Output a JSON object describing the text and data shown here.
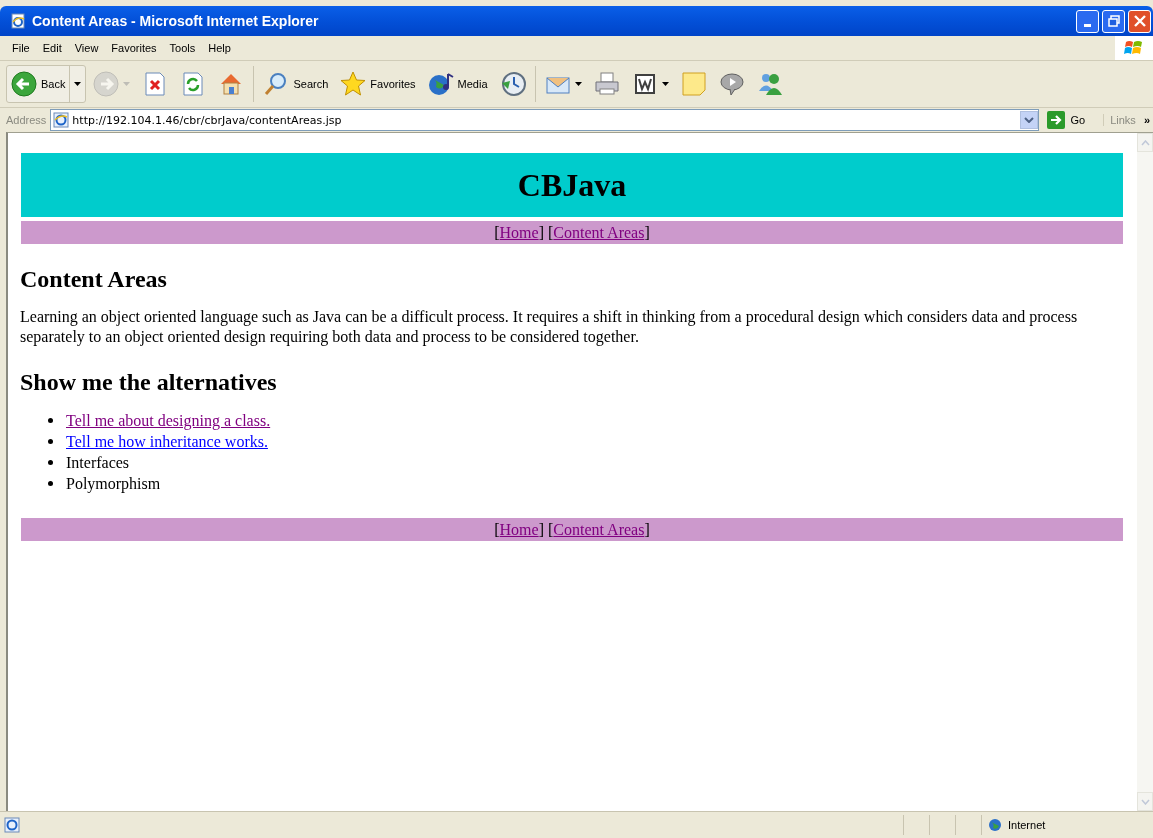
{
  "window": {
    "title": "Content Areas - Microsoft Internet Explorer"
  },
  "menu": [
    {
      "label": "File"
    },
    {
      "label": "Edit"
    },
    {
      "label": "View"
    },
    {
      "label": "Favorites"
    },
    {
      "label": "Tools"
    },
    {
      "label": "Help"
    }
  ],
  "toolbar": [
    {
      "kind": "back",
      "label": "Back",
      "disabled": false
    },
    {
      "kind": "forward",
      "disabled": true
    },
    {
      "kind": "stop",
      "disabled": false
    },
    {
      "kind": "refresh",
      "disabled": false
    },
    {
      "kind": "home",
      "disabled": false
    },
    {
      "kind": "search",
      "label": "Search",
      "disabled": false
    },
    {
      "kind": "favorites",
      "label": "Favorites",
      "disabled": false
    },
    {
      "kind": "media",
      "label": "Media",
      "disabled": false
    },
    {
      "kind": "history",
      "disabled": false
    },
    {
      "kind": "mail",
      "disabled": false
    },
    {
      "kind": "print",
      "disabled": false
    },
    {
      "kind": "edit",
      "disabled": false
    },
    {
      "kind": "note",
      "disabled": false
    },
    {
      "kind": "discuss",
      "disabled": false
    },
    {
      "kind": "messenger",
      "disabled": false
    }
  ],
  "address_bar": {
    "label": "Address",
    "value": "http://192.104.1.46/cbr/cbrJava/contentAreas.jsp",
    "go": "Go",
    "links": "Links",
    "more": "»"
  },
  "page": {
    "banner": "CBJava",
    "nav_top": [
      {
        "kind": "text",
        "text": "["
      },
      {
        "kind": "link",
        "text": "Home",
        "visited": true
      },
      {
        "kind": "text",
        "text": "] ["
      },
      {
        "kind": "link",
        "text": "Content Areas",
        "visited": true
      },
      {
        "kind": "text",
        "text": "]"
      }
    ],
    "heading": "Content Areas",
    "paragraph": "Learning an object oriented language such as Java can be a difficult process. It requires a shift in thinking from a procedural design which considers data and process separately to an object oriented design requiring both data and process to be considered together.",
    "subheading": "Show me the alternatives",
    "items": [
      {
        "kind": "link",
        "text": "Tell me about designing a class.",
        "visited": true
      },
      {
        "kind": "link",
        "text": "Tell me how inheritance works.",
        "visited": false
      },
      {
        "kind": "text",
        "text": "Interfaces"
      },
      {
        "kind": "text",
        "text": "Polymorphism"
      }
    ],
    "nav_bottom": [
      {
        "kind": "text",
        "text": "["
      },
      {
        "kind": "link",
        "text": "Home",
        "visited": true
      },
      {
        "kind": "text",
        "text": "] ["
      },
      {
        "kind": "link",
        "text": "Content Areas",
        "visited": true
      },
      {
        "kind": "text",
        "text": "]"
      }
    ]
  },
  "status_bar": {
    "zone": "Internet"
  }
}
